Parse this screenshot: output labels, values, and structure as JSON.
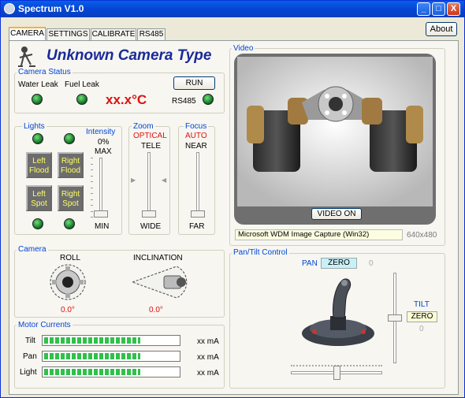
{
  "window": {
    "title": "Spectrum V1.0",
    "minimize": "_",
    "maximize": "□",
    "close": "X"
  },
  "tabs": [
    "CAMERA",
    "SETTINGS",
    "CALIBRATE",
    "RS485"
  ],
  "about_label": "About",
  "camera_type": "Unknown Camera Type",
  "camera_status": {
    "label": "Camera Status",
    "water_leak": "Water Leak",
    "fuel_leak": "Fuel Leak",
    "temperature": "xx.x°C",
    "run_label": "RUN",
    "rs485": "RS485"
  },
  "lights": {
    "label": "Lights",
    "intensity": "Intensity",
    "percent": "0%",
    "max": "MAX",
    "min": "MIN",
    "level": 0,
    "left_flood": "Left Flood",
    "right_flood": "Right Flood",
    "left_spot": "Left Spot",
    "right_spot": "Right Spot"
  },
  "zoom": {
    "label": "Zoom",
    "mode": "OPTICAL",
    "top": "TELE",
    "bottom": "WIDE",
    "level": 0
  },
  "focus": {
    "label": "Focus",
    "mode": "AUTO",
    "top": "NEAR",
    "bottom": "FAR",
    "level": 0
  },
  "video": {
    "label": "Video",
    "button": "VIDEO ON",
    "device": "Microsoft WDM Image Capture (Win32)",
    "resolution": "640x480"
  },
  "camera": {
    "label": "Camera",
    "roll_label": "ROLL",
    "inclination_label": "INCLINATION",
    "roll_value": "0.0°",
    "inclination_value": "0.0°"
  },
  "motor": {
    "label": "Motor Currents",
    "rows": [
      {
        "name": "Tilt",
        "unit": "xx mA",
        "level": 0.72
      },
      {
        "name": "Pan",
        "unit": "xx mA",
        "level": 0.72
      },
      {
        "name": "Light",
        "unit": "xx mA",
        "level": 0.72
      }
    ]
  },
  "pantilt": {
    "label": "Pan/Tilt Control",
    "pan_label": "PAN",
    "pan_zero": "ZERO",
    "pan_value": "0",
    "tilt_label": "TILT",
    "tilt_zero": "ZERO",
    "tilt_value": "0"
  },
  "colors": {
    "accent": "#0046d5",
    "title_blue": "#1a2a9a",
    "alert_red": "#e01010",
    "led_green": "#0c6b1e"
  }
}
